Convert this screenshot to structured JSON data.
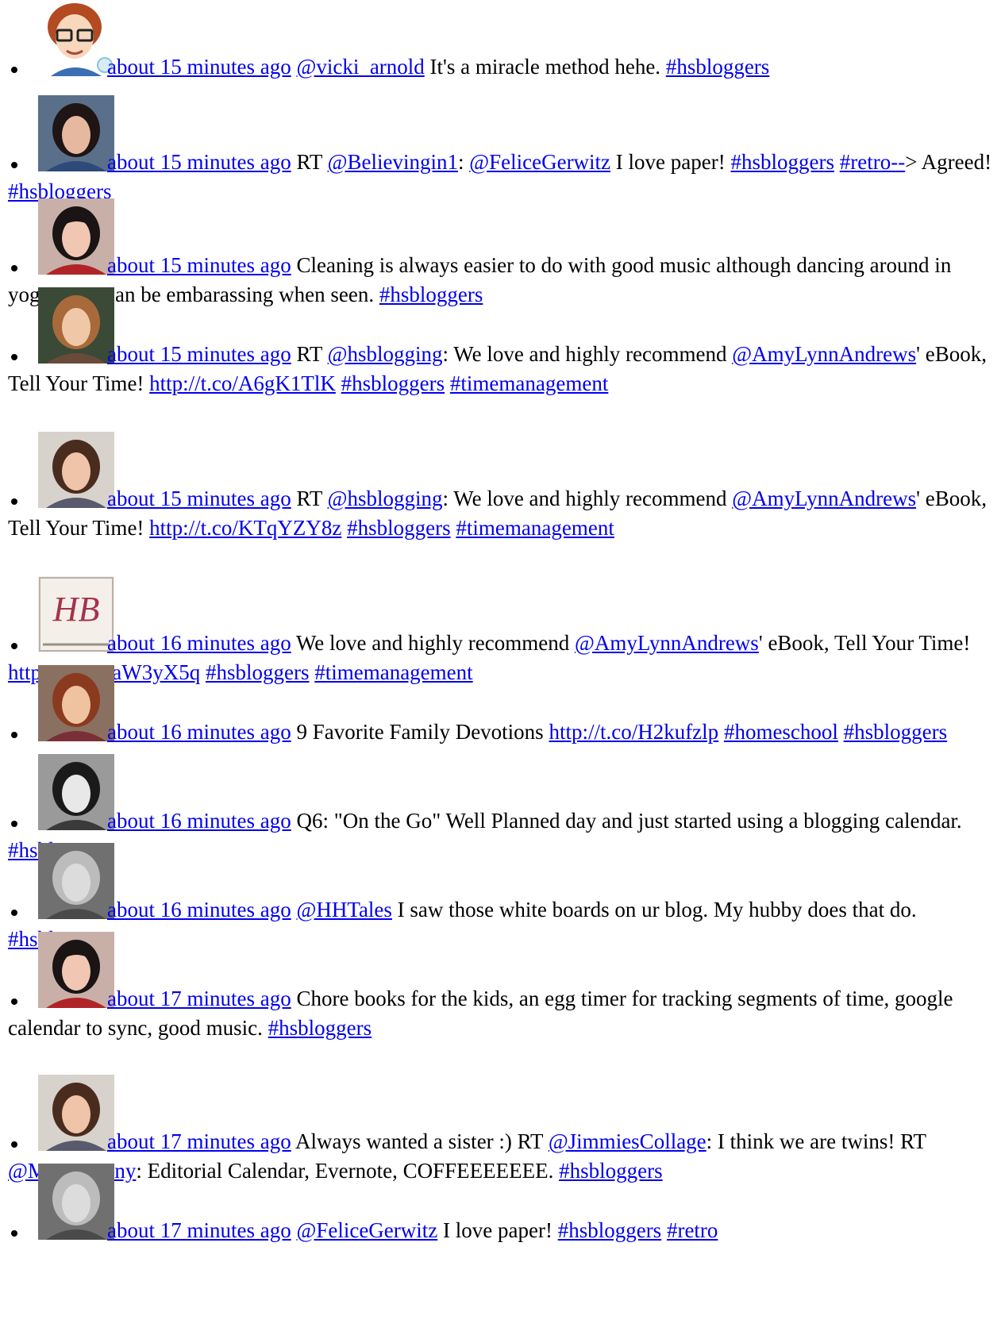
{
  "colors": {
    "link": "#0000ee",
    "text": "#000000",
    "background": "#ffffff"
  },
  "tweets": [
    {
      "avatar": "cartoon-avatar",
      "avatar_style": "cartoon",
      "parts": [
        {
          "t": "link",
          "v": "about 15 minutes ago"
        },
        {
          "t": "text",
          "v": " "
        },
        {
          "t": "link",
          "v": "@vicki_arnold"
        },
        {
          "t": "text",
          "v": " It's a miracle method hehe. "
        },
        {
          "t": "link",
          "v": "#hsbloggers"
        }
      ]
    },
    {
      "avatar": "woman-dark-hair-avatar",
      "avatar_style": "dark",
      "parts": [
        {
          "t": "link",
          "v": "about 15 minutes ago"
        },
        {
          "t": "text",
          "v": " RT "
        },
        {
          "t": "link",
          "v": "@Believingin1"
        },
        {
          "t": "text",
          "v": ": "
        },
        {
          "t": "link",
          "v": "@FeliceGerwitz"
        },
        {
          "t": "text",
          "v": " I love paper! "
        },
        {
          "t": "link",
          "v": "#hsbloggers"
        },
        {
          "t": "text",
          "v": " "
        },
        {
          "t": "link",
          "v": "#retro--"
        },
        {
          "t": "text",
          "v": "> Agreed! "
        },
        {
          "t": "link",
          "v": "#hsbloggers"
        }
      ]
    },
    {
      "avatar": "woman-bangs-avatar",
      "avatar_style": "bangs",
      "parts": [
        {
          "t": "link",
          "v": "about 15 minutes ago"
        },
        {
          "t": "text",
          "v": " Cleaning is always easier to do with good music although dancing around in yoga pants can be embarassing when seen. "
        },
        {
          "t": "link",
          "v": "#hsbloggers"
        }
      ]
    },
    {
      "avatar": "woman-smiling-avatar",
      "avatar_style": "smile",
      "parts": [
        {
          "t": "link",
          "v": "about 15 minutes ago"
        },
        {
          "t": "text",
          "v": " RT "
        },
        {
          "t": "link",
          "v": "@hsblogging"
        },
        {
          "t": "text",
          "v": ": We love and highly recommend "
        },
        {
          "t": "link",
          "v": "@AmyLynnAndrews"
        },
        {
          "t": "text",
          "v": "' eBook, Tell Your Time! "
        },
        {
          "t": "link",
          "v": "http://t.co/A6gK1TlK"
        },
        {
          "t": "text",
          "v": " "
        },
        {
          "t": "link",
          "v": "#hsbloggers"
        },
        {
          "t": "text",
          "v": " "
        },
        {
          "t": "link",
          "v": "#timemanagement"
        }
      ]
    },
    {
      "avatar": "woman-brunette-avatar",
      "avatar_style": "brunette",
      "parts": [
        {
          "t": "link",
          "v": "about 15 minutes ago"
        },
        {
          "t": "text",
          "v": " RT "
        },
        {
          "t": "link",
          "v": "@hsblogging"
        },
        {
          "t": "text",
          "v": ": We love and highly recommend "
        },
        {
          "t": "link",
          "v": "@AmyLynnAndrews"
        },
        {
          "t": "text",
          "v": "' eBook, Tell Your Time! "
        },
        {
          "t": "link",
          "v": "http://t.co/KTqYZY8z"
        },
        {
          "t": "text",
          "v": " "
        },
        {
          "t": "link",
          "v": "#hsbloggers"
        },
        {
          "t": "text",
          "v": " "
        },
        {
          "t": "link",
          "v": "#timemanagement"
        }
      ]
    },
    {
      "avatar": "hb-logo-avatar",
      "avatar_style": "logo",
      "logo_text": "HB",
      "parts": [
        {
          "t": "link",
          "v": "about 16 minutes ago"
        },
        {
          "t": "text",
          "v": " We love and highly recommend "
        },
        {
          "t": "link",
          "v": "@AmyLynnAndrews"
        },
        {
          "t": "text",
          "v": "' eBook, Tell Your Time! "
        },
        {
          "t": "link",
          "v": "http://t.co/GaW3yX5q"
        },
        {
          "t": "text",
          "v": " "
        },
        {
          "t": "link",
          "v": "#hsbloggers"
        },
        {
          "t": "text",
          "v": " "
        },
        {
          "t": "link",
          "v": "#timemanagement"
        }
      ]
    },
    {
      "avatar": "woman-auburn-avatar",
      "avatar_style": "auburn",
      "parts": [
        {
          "t": "link",
          "v": "about 16 minutes ago"
        },
        {
          "t": "text",
          "v": " 9 Favorite Family Devotions "
        },
        {
          "t": "link",
          "v": "http://t.co/H2kufzlp"
        },
        {
          "t": "text",
          "v": " "
        },
        {
          "t": "link",
          "v": "#homeschool"
        },
        {
          "t": "text",
          "v": " "
        },
        {
          "t": "link",
          "v": "#hsbloggers"
        }
      ]
    },
    {
      "avatar": "woman-bw-avatar",
      "avatar_style": "bw",
      "parts": [
        {
          "t": "link",
          "v": "about 16 minutes ago"
        },
        {
          "t": "text",
          "v": " Q6: \"On the Go\" Well Planned day and just started using a blogging calendar. "
        },
        {
          "t": "link",
          "v": "#hsbloggers"
        }
      ]
    },
    {
      "avatar": "woman-gray-avatar",
      "avatar_style": "gray",
      "parts": [
        {
          "t": "link",
          "v": "about 16 minutes ago"
        },
        {
          "t": "text",
          "v": " "
        },
        {
          "t": "link",
          "v": "@HHTales"
        },
        {
          "t": "text",
          "v": " I saw those white boards on ur blog. My hubby does that do. "
        },
        {
          "t": "link",
          "v": "#hsbloggers"
        }
      ]
    },
    {
      "avatar": "woman-bangs-avatar",
      "avatar_style": "bangs",
      "parts": [
        {
          "t": "link",
          "v": "about 17 minutes ago"
        },
        {
          "t": "text",
          "v": " Chore books for the kids, an egg timer for tracking segments of time, google calendar to sync, good music. "
        },
        {
          "t": "link",
          "v": "#hsbloggers"
        }
      ]
    },
    {
      "avatar": "woman-brunette-avatar",
      "avatar_style": "brunette",
      "parts": [
        {
          "t": "link",
          "v": "about 17 minutes ago"
        },
        {
          "t": "text",
          "v": " Always wanted a sister :) RT "
        },
        {
          "t": "link",
          "v": "@JimmiesCollage"
        },
        {
          "t": "text",
          "v": ": I think we are twins! RT "
        },
        {
          "t": "link",
          "v": "@Meet_Penny"
        },
        {
          "t": "text",
          "v": ": Editorial Calendar, Evernote, COFFEEEEEEE. "
        },
        {
          "t": "link",
          "v": "#hsbloggers"
        }
      ]
    },
    {
      "avatar": "woman-gray-avatar",
      "avatar_style": "gray",
      "parts": [
        {
          "t": "link",
          "v": "about 17 minutes ago"
        },
        {
          "t": "text",
          "v": " "
        },
        {
          "t": "link",
          "v": "@FeliceGerwitz"
        },
        {
          "t": "text",
          "v": " I love paper! "
        },
        {
          "t": "link",
          "v": "#hsbloggers"
        },
        {
          "t": "text",
          "v": " "
        },
        {
          "t": "link",
          "v": "#retro"
        }
      ]
    }
  ]
}
